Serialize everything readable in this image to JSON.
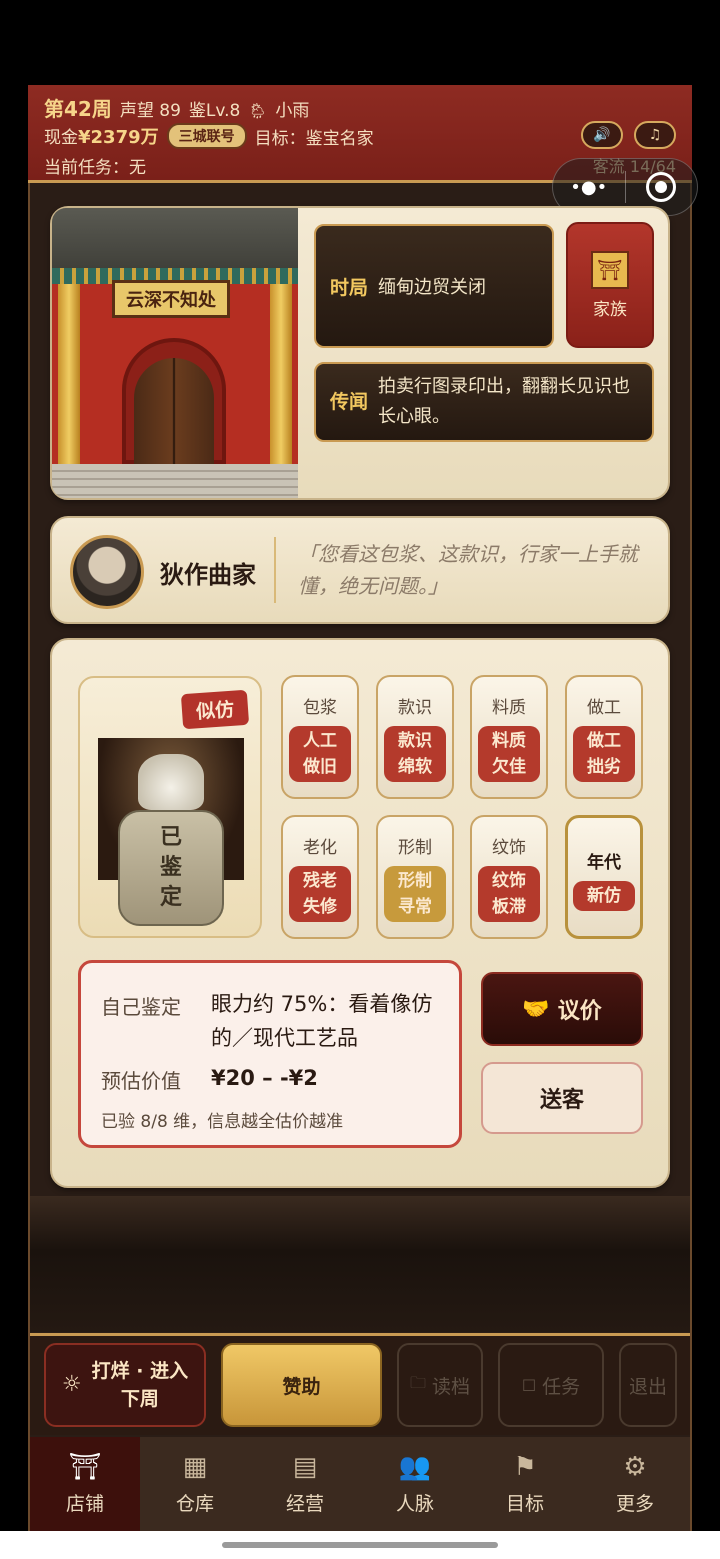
{
  "header": {
    "week": "第42周",
    "reputation": "声望 89",
    "level": "鉴Lv.8",
    "weather_icon": "🌦",
    "weather": "小雨",
    "cash_label": "现金",
    "cash": "¥2379万",
    "badge": "三城联号",
    "goal": "目标：鉴宝名家",
    "task": "当前任务：无",
    "traffic": "客流 14/64",
    "sound_icon": "🔊",
    "music_icon": "♫"
  },
  "capsule": {
    "more": "•●•"
  },
  "shop": {
    "plaque": "云深不知处",
    "situation_tag": "时局",
    "situation": "缅甸边贸关闭",
    "rumor_tag": "传闻",
    "rumor": "拍卖行图录印出，翻翻长见识也长心眼。",
    "family_label": "家族",
    "family_icon": "⛩"
  },
  "npc": {
    "name": "狄作曲家",
    "quote": "「您看这包浆、这款识，行家一上手就懂，绝无问题。」"
  },
  "item": {
    "verdict_tag": "似仿",
    "stamp_lines": [
      "已",
      "鉴",
      "定"
    ]
  },
  "attributes": [
    {
      "label": "包浆",
      "value_lines": [
        "人工",
        "做旧"
      ],
      "style": "red"
    },
    {
      "label": "款识",
      "value_lines": [
        "款识",
        "绵软"
      ],
      "style": "red"
    },
    {
      "label": "料质",
      "value_lines": [
        "料质",
        "欠佳"
      ],
      "style": "red"
    },
    {
      "label": "做工",
      "value_lines": [
        "做工",
        "拙劣"
      ],
      "style": "red"
    },
    {
      "label": "老化",
      "value_lines": [
        "残老",
        "失修"
      ],
      "style": "red"
    },
    {
      "label": "形制",
      "value_lines": [
        "形制",
        "寻常"
      ],
      "style": "gold"
    },
    {
      "label": "纹饰",
      "value_lines": [
        "纹饰",
        "板滞"
      ],
      "style": "red"
    },
    {
      "label": "年代",
      "value_lines": [
        "新仿"
      ],
      "style": "red"
    }
  ],
  "appraisal": {
    "self_label": "自己鉴定",
    "self_value": "眼力约 75%：看着像仿的／现代工艺品",
    "estimate_label": "预估价值",
    "estimate_value": "¥20 – -¥2",
    "note": "已验 8/8 维，信息越全估价越准"
  },
  "buttons": {
    "bargain": "议价",
    "bargain_icon": "🤝",
    "send_off": "送客"
  },
  "actions": {
    "close_icon": "☼",
    "close_line1": "打烊 · 进入",
    "close_line2": "下周",
    "sponsor": "赞助",
    "load": "读档",
    "tasks": "任务",
    "exit": "退出"
  },
  "tabs": [
    {
      "label": "店铺",
      "icon": "⛩"
    },
    {
      "label": "仓库",
      "icon": "▦"
    },
    {
      "label": "经营",
      "icon": "▤"
    },
    {
      "label": "人脉",
      "icon": "👥"
    },
    {
      "label": "目标",
      "icon": "⚑"
    },
    {
      "label": "更多",
      "icon": "⚙"
    }
  ],
  "colors": {
    "header_red": "#8e2b22",
    "gold": "#c99a52",
    "tag_red": "#b43a2c"
  }
}
